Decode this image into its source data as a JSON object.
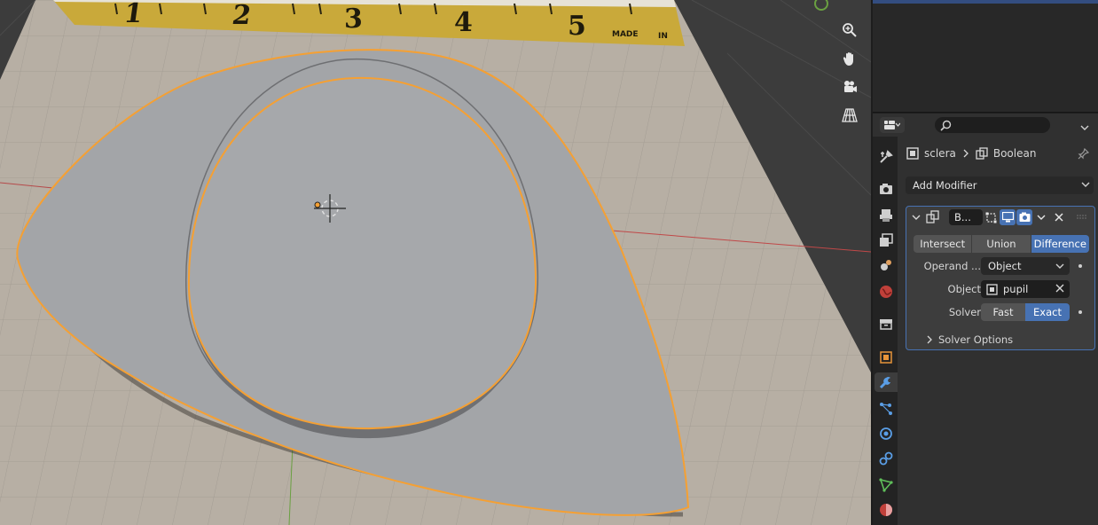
{
  "ruler": {
    "numbers": [
      "1",
      "2",
      "3",
      "4",
      "5"
    ],
    "brand": "MADE",
    "suffix": "IN"
  },
  "properties": {
    "breadcrumb": {
      "object": "sclera",
      "modifier": "Boolean"
    },
    "add_modifier": "Add Modifier",
    "modifier": {
      "name": "B...",
      "operations": [
        "Intersect",
        "Union",
        "Difference"
      ],
      "selected_operation": "Difference",
      "operand_label": "Operand ...",
      "operand_value": "Object",
      "object_label": "Object",
      "object_value": "pupil",
      "solver_label": "Solver",
      "solvers": [
        "Fast",
        "Exact"
      ],
      "selected_solver": "Exact",
      "solver_options": "Solver Options"
    }
  },
  "tabs": [
    "tool-icon",
    "render-icon",
    "output-icon",
    "view-layer-icon",
    "scene-icon",
    "world-icon",
    "collection-icon",
    "object-icon",
    "modifier-icon",
    "particles-icon",
    "physics-icon",
    "constraints-icon",
    "data-icon",
    "material-icon"
  ],
  "active_tab": "modifier-icon",
  "colors": {
    "accent": "#4772b3",
    "selection_outline": "#f5a033",
    "mesh": "#a3a5a8"
  }
}
